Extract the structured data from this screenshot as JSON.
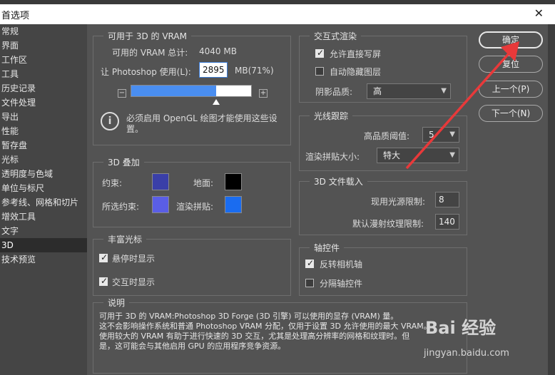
{
  "window": {
    "title": "首选项",
    "close_glyph": "✕"
  },
  "sidebar": {
    "items": [
      "常规",
      "界面",
      "工作区",
      "工具",
      "历史记录",
      "文件处理",
      "导出",
      "性能",
      "暂存盘",
      "光标",
      "透明度与色域",
      "单位与标尺",
      "参考线、网格和切片",
      "增效工具",
      "文字",
      "3D",
      "技术预览"
    ],
    "active_index": 15
  },
  "vram": {
    "legend": "可用于 3D 的 VRAM",
    "available_label": "可用的 VRAM 总计:",
    "available_value": "4040 MB",
    "use_label": "让 Photoshop 使用(L):",
    "use_value": "2895",
    "use_unit": "MB(71%)",
    "slider_percent": 71,
    "minus": "−",
    "plus": "+",
    "info_icon": "info-icon",
    "note": "必须启用 OpenGL 绘图才能使用这些设置。"
  },
  "overlays": {
    "legend": "3D 叠加",
    "constraint_label": "约束:",
    "ground_label": "地面:",
    "selected_constraint_label": "所选约束:",
    "render_tile_label": "渲染拼贴:",
    "colors": {
      "constraint": "#3a3fa8",
      "ground": "#000000",
      "selected_constraint": "#5a5ee6",
      "render_tile": "#1a6cf0"
    }
  },
  "rich_cursor": {
    "legend": "丰富光标",
    "show_on_hover": "悬停时显示",
    "show_on_hover_checked": true,
    "show_on_interact": "交互时显示",
    "show_on_interact_checked": true
  },
  "interactive_render": {
    "legend": "交互式渲染",
    "allow_direct_write": "允许直接写屏",
    "allow_direct_write_checked": true,
    "auto_hide_layers": "自动隐藏图层",
    "auto_hide_layers_checked": false,
    "shadow_quality_label": "阴影品质:",
    "shadow_quality_value": "高"
  },
  "ray_tracer": {
    "legend": "光线跟踪",
    "threshold_label": "高品质阈值:",
    "threshold_value": "5",
    "tile_size_label": "渲染拼贴大小:",
    "tile_size_value": "特大"
  },
  "file_loading": {
    "legend": "3D 文件载入",
    "light_limit_label": "现用光源限制:",
    "light_limit_value": "8",
    "diffuse_limit_label": "默认漫射纹理限制:",
    "diffuse_limit_value": "140"
  },
  "axis_widget": {
    "legend": "轴控件",
    "invert_camera": "反转相机轴",
    "invert_camera_checked": true,
    "separate_axis": "分隔轴控件",
    "separate_axis_checked": false
  },
  "description": {
    "legend": "说明",
    "lines": [
      "可用于 3D 的 VRAM:Photoshop 3D Forge (3D 引擎) 可以使用的显存 (VRAM) 量。",
      "这不会影响操作系统和普通 Photoshop VRAM 分配，仅用于设置 3D 允许使用的最大 VRAM。",
      "使用较大的 VRAM 有助于进行快速的 3D 交互，尤其是处理高分辨率的网格和纹理时。但",
      "是，这可能会与其他启用 GPU 的应用程序竞争资源。"
    ]
  },
  "buttons": {
    "ok": "确定",
    "reset": "复位",
    "prev": "上一个(P)",
    "next": "下一个(N)"
  },
  "watermark": {
    "brand": "Bai 经验",
    "url": "jingyan.baidu.com"
  },
  "annotation": {
    "color": "#e8393a"
  }
}
